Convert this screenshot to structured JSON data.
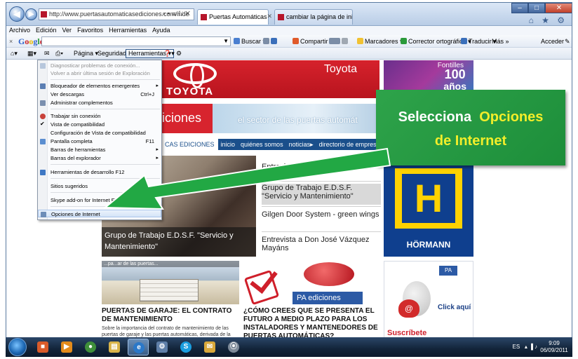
{
  "browser": {
    "address": "http://www.puertasautomaticasediciones.com/inde",
    "address_controls": "⌕ ▾ ☰ ↻ ✕",
    "tabs": [
      {
        "title": "Puertas Automáticas - Puer..."
      },
      {
        "title": "cambiar la página de inicio de ..."
      }
    ],
    "window_controls": {
      "minimize": "–",
      "maximize": "□",
      "close": "✕"
    },
    "right_icons": "⌂ ★ ⚙"
  },
  "menubar": [
    "Archivo",
    "Edición",
    "Ver",
    "Favoritos",
    "Herramientas",
    "Ayuda"
  ],
  "google_toolbar": {
    "close": "×",
    "logo": "Google",
    "items": {
      "buscar": "Buscar ▾",
      "compartir": "Compartir ▾",
      "marcadores": "Marcadores ▾",
      "corrector": "Corrector ortográfico ▾",
      "traducir": "Traducir ▾",
      "mas": "Más »",
      "acceder": "Acceder"
    }
  },
  "command_bar": {
    "pagina": "Página ▾",
    "seguridad": "Seguridad ▾",
    "herramientas": "Herramientas ▾",
    "ayuda": "▾"
  },
  "tools_menu": {
    "items": [
      {
        "label": "Diagnosticar problemas de conexión...",
        "disabled": true
      },
      {
        "label": "Volver a abrir última sesión de Exploración",
        "disabled": true
      },
      {
        "label": "Bloqueador de elementos emergentes",
        "submenu": "▸"
      },
      {
        "label": "Ver descargas",
        "shortcut": "Ctrl+J"
      },
      {
        "label": "Administrar complementos"
      },
      {
        "label": "Trabajar sin conexión"
      },
      {
        "label": "Vista de compatibilidad",
        "checked": "✔"
      },
      {
        "label": "Configuración de Vista de compatibilidad"
      },
      {
        "label": "Pantalla completa",
        "shortcut": "F11"
      },
      {
        "label": "Barras de herramientas",
        "submenu": "▸"
      },
      {
        "label": "Barras del explorador",
        "submenu": "▸"
      },
      {
        "label": "Herramientas de desarrollo F12"
      },
      {
        "label": "Sitios sugeridos"
      },
      {
        "label": "Skype add-on for Internet Explorer"
      },
      {
        "label": "Opciones de Internet"
      }
    ]
  },
  "webpage": {
    "toyota": {
      "logo_word": "TOYOTA",
      "brand": "Toyota"
    },
    "fontilles": {
      "name": "Fontilles",
      "years": "100",
      "years_label": "años"
    },
    "pa_banner": "iciones",
    "sector": "el sector de las puertas automát",
    "nav": [
      "CAS EDICIONES",
      "inicio",
      "quiénes somos",
      "noticias▸",
      "directorio de empresas▸"
    ],
    "main_photo_caption": "Grupo de Trabajo E.D.S.F. \"Servicio y Mantenimiento\"",
    "news_list": [
      "Entrevista a Mr. Jan Dr... presi...",
      "Grupo de Trabajo E.D.S.F. \"Servicio y Mantenimiento\"",
      "Gilgen Door System - green wings",
      "Entrevista a Don José Vázquez Mayáns"
    ],
    "hormann": {
      "letter": "H",
      "brand": "HÖRMANN"
    },
    "house_photo_label": "...pa...ar de las puertas...",
    "article1": {
      "title": "PUERTAS DE GARAJE: EL CONTRATO DE MANTENIMIENTO",
      "body": "Sobre la importancia del contrato de mantenimiento de las puertas de garaje y las puertas automáticas, derivada de la obligación legal de llevar un mantenimiento de las puertas con"
    },
    "pa_logo": "PA ediciones",
    "article2": {
      "title": "¿CÓMO CREES QUE SE PRESENTA EL FUTURO A MEDIO PLAZO PARA LOS INSTALADORES Y MANTENEDORES DE PUERTAS AUTOMÁTICAS?"
    },
    "click_ad": {
      "badge": "PA",
      "at": "@",
      "click": "Click aquí",
      "subscribe": "Suscríbete"
    }
  },
  "annotation": {
    "line1_prefix": "Selecciona",
    "line1_highlight": "Opciones",
    "line2": "de Internet"
  },
  "taskbar": {
    "apps": [
      "■",
      "▶",
      "●",
      "▤",
      "e",
      "⚙",
      "S",
      "✉",
      "⦿"
    ],
    "tray_lang": "ES",
    "tray_icons": "▴ ▐ ♪",
    "time": "9:09",
    "date": "06/09/2011"
  },
  "colors": {
    "accent": "#1d8e3a",
    "highlight_text": "#f2ee2a",
    "arrow": "#22a844",
    "toyota_red": "#d6222c"
  }
}
